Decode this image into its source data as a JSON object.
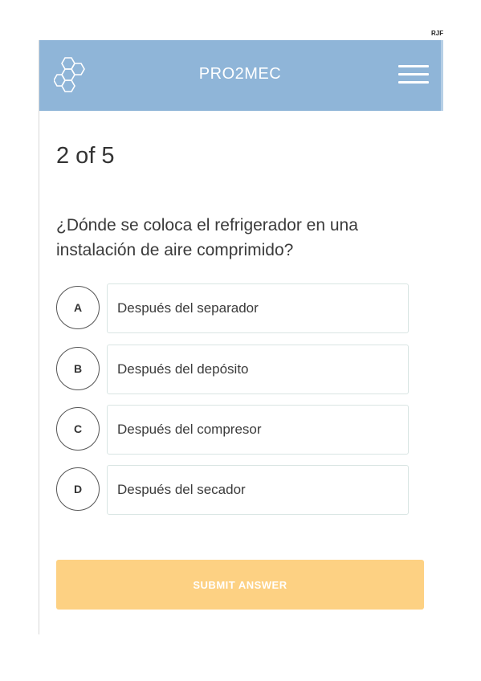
{
  "corner_tag": "RJF",
  "header": {
    "title": "PRO2MEC",
    "logo_icon": "hexagon-cluster-logo",
    "menu_icon": "hamburger-menu-icon",
    "background_color": "#8fb5d8"
  },
  "quiz": {
    "progress": "2 of 5",
    "question": "¿Dónde se coloca el refrigerador en una instalación de aire comprimido?",
    "options": [
      {
        "letter": "A",
        "text": "Después del separador"
      },
      {
        "letter": "B",
        "text": "Después del depósito"
      },
      {
        "letter": "C",
        "text": "Después del compresor"
      },
      {
        "letter": "D",
        "text": "Después del secador"
      }
    ],
    "submit_label": "SUBMIT ANSWER",
    "submit_color": "#fdd183"
  }
}
